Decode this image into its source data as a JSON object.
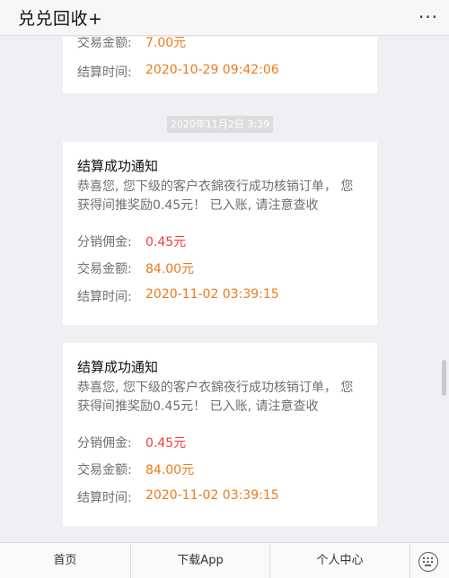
{
  "header": {
    "title": "兑兑回收+",
    "more_label": "···"
  },
  "top_card": {
    "amount_label": "交易金额:",
    "amount_value": "7.00元",
    "time_label": "结算时间:",
    "time_value": "2020-10-29 09:42:06"
  },
  "timestamp": "2020年11月2日 3:39",
  "cards": [
    {
      "title": "结算成功通知",
      "description": "恭喜您, 您下级的客户衣錦夜行成功核销订单， 您获得间推奖励0.45元！ 已入账, 请注意查收",
      "commission_label": "分销佣金:",
      "commission_value": "0.45元",
      "amount_label": "交易金额:",
      "amount_value": "84.00元",
      "time_label": "结算时间:",
      "time_value": "2020-11-02 03:39:15"
    },
    {
      "title": "结算成功通知",
      "description": "恭喜您, 您下级的客户衣錦夜行成功核销订单， 您获得间推奖励0.45元！ 已入账, 请注意查收",
      "commission_label": "分销佣金:",
      "commission_value": "0.45元",
      "amount_label": "交易金额:",
      "amount_value": "84.00元",
      "time_label": "结算时间:",
      "time_value": "2020-11-02 03:39:15"
    }
  ],
  "bottom_nav": {
    "home": "首页",
    "download": "下载App",
    "profile": "个人中心"
  },
  "colors": {
    "value_red": "#f0403a",
    "value_orange": "#ee7a1a"
  }
}
